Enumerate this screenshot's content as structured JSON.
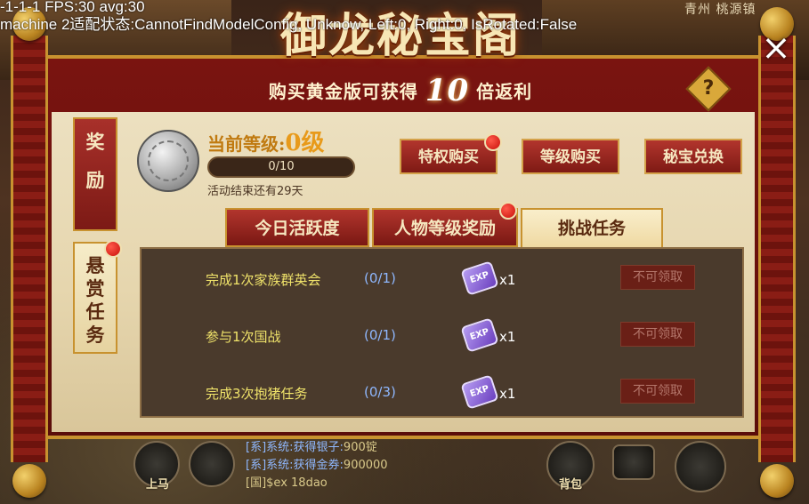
{
  "debug": {
    "line1": "-1-1-1 FPS:30 avg:30",
    "line2": "machine 2适配状态:CannotFindModelConfig, Unknow, Left:0, Right:0, IsRotated:False"
  },
  "world": {
    "city_label": "青州 桃源镇"
  },
  "window": {
    "title": "御龙秘宝阁",
    "subtitle_pre": "购买黄金版可获得",
    "subtitle_num": "10",
    "subtitle_post": "倍返利",
    "help_icon": "?",
    "close_icon": "×"
  },
  "side_tabs": [
    {
      "label_line1": "奖",
      "label_line2": "励",
      "active": false
    },
    {
      "label_line1": "悬赏",
      "label_line2": "任务",
      "active": true,
      "badge": true
    }
  ],
  "status": {
    "level_prefix": "当前等级:",
    "level_value": "0级",
    "progress_text": "0/10",
    "progress_fraction": 0,
    "countdown": "活动结束还有29天"
  },
  "top_buttons": [
    {
      "label": "特权购买",
      "badge": true
    },
    {
      "label": "等级购买",
      "badge": false
    },
    {
      "label": "秘宝兑换",
      "badge": false
    }
  ],
  "tabs": [
    {
      "label": "今日活跃度",
      "active": false,
      "badge": false
    },
    {
      "label": "人物等级奖励",
      "active": false,
      "badge": true
    },
    {
      "label": "挑战任务",
      "active": true,
      "badge": false
    }
  ],
  "tasks": [
    {
      "name": "完成1次家族群英会",
      "progress": "(0/1)",
      "reward_icon": "exp-ticket-icon",
      "reward_label": "EXP",
      "qty": "x1",
      "claim": "不可领取"
    },
    {
      "name": "参与1次国战",
      "progress": "(0/1)",
      "reward_icon": "exp-ticket-icon",
      "reward_label": "EXP",
      "qty": "x1",
      "claim": "不可领取"
    },
    {
      "name": "完成3次抱猪任务",
      "progress": "(0/3)",
      "reward_icon": "exp-ticket-icon",
      "reward_label": "EXP",
      "qty": "x1",
      "claim": "不可领取"
    }
  ],
  "chat": [
    {
      "channel": "[系]",
      "text": "系统:获得银子:",
      "value": "900锭"
    },
    {
      "channel": "[系]",
      "text": "系统:获得金券:",
      "value": "900000"
    },
    {
      "channel": "[国]",
      "text": "$ex 18dao",
      "value": ""
    }
  ],
  "hud": {
    "mount_label": "上马",
    "bag_label": "背包"
  }
}
